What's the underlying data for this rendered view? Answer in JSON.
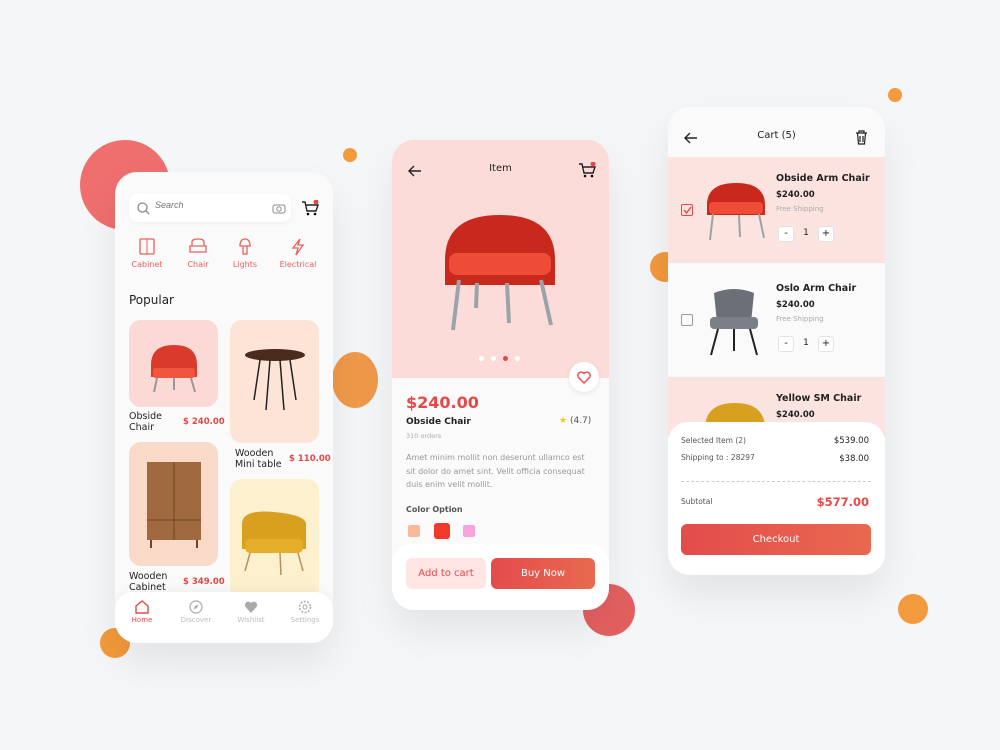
{
  "colors": {
    "accent": "#e54848",
    "bg": "#f5f6f8"
  },
  "home": {
    "search_placeholder": "Search",
    "categories": [
      {
        "label": "Cabinet",
        "icon": "cabinet-icon"
      },
      {
        "label": "Chair",
        "icon": "chair-icon"
      },
      {
        "label": "Lights",
        "icon": "lamp-icon"
      },
      {
        "label": "Electrical",
        "icon": "lightning-icon"
      }
    ],
    "section_title": "Popular",
    "products": [
      {
        "name_1": "Obside",
        "name_2": "Chair",
        "price": "$ 240.00"
      },
      {
        "name_1": "Wooden",
        "name_2": "Mini table",
        "price": "$ 110.00"
      },
      {
        "name_1": "Wooden",
        "name_2": "Cabinet",
        "price": "$ 349.00"
      }
    ],
    "nav": [
      {
        "label": "Home",
        "icon": "home-icon"
      },
      {
        "label": "Discover",
        "icon": "compass-icon"
      },
      {
        "label": "Wishlist",
        "icon": "heart-icon"
      },
      {
        "label": "Settings",
        "icon": "gear-icon"
      }
    ]
  },
  "item": {
    "title": "Item",
    "price": "$240.00",
    "name": "Obside Chair",
    "orders": "310 orders",
    "rating": "(4.7)",
    "description": "Amet minim mollit non deserunt ullamco est sit dolor do amet sint. Velit officia consequat duis enim velit mollit.",
    "color_label": "Color Option",
    "colors": [
      "#f7b99a",
      "#f0392b",
      "#f7a3dc"
    ],
    "selected_color": 1,
    "add_to_cart": "Add to cart",
    "buy_now": "Buy Now"
  },
  "cart": {
    "title": "Cart (5)",
    "items": [
      {
        "name": "Obside Arm Chair",
        "price": "$240.00",
        "shipping": "Free Shipping",
        "qty": "1",
        "checked": true
      },
      {
        "name": "Oslo Arm Chair",
        "price": "$240.00",
        "shipping": "Free Shipping",
        "qty": "1",
        "checked": false
      },
      {
        "name": "Yellow SM Chair",
        "price": "$240.00"
      }
    ],
    "selected_label": "Selected Item (2)",
    "selected_value": "$539.00",
    "shipping_label": "Shipping to : 28297",
    "shipping_value": "$38.00",
    "subtotal_label": "Subtotal",
    "subtotal_value": "$577.00",
    "checkout": "Checkout",
    "minus": "-",
    "plus": "+"
  }
}
